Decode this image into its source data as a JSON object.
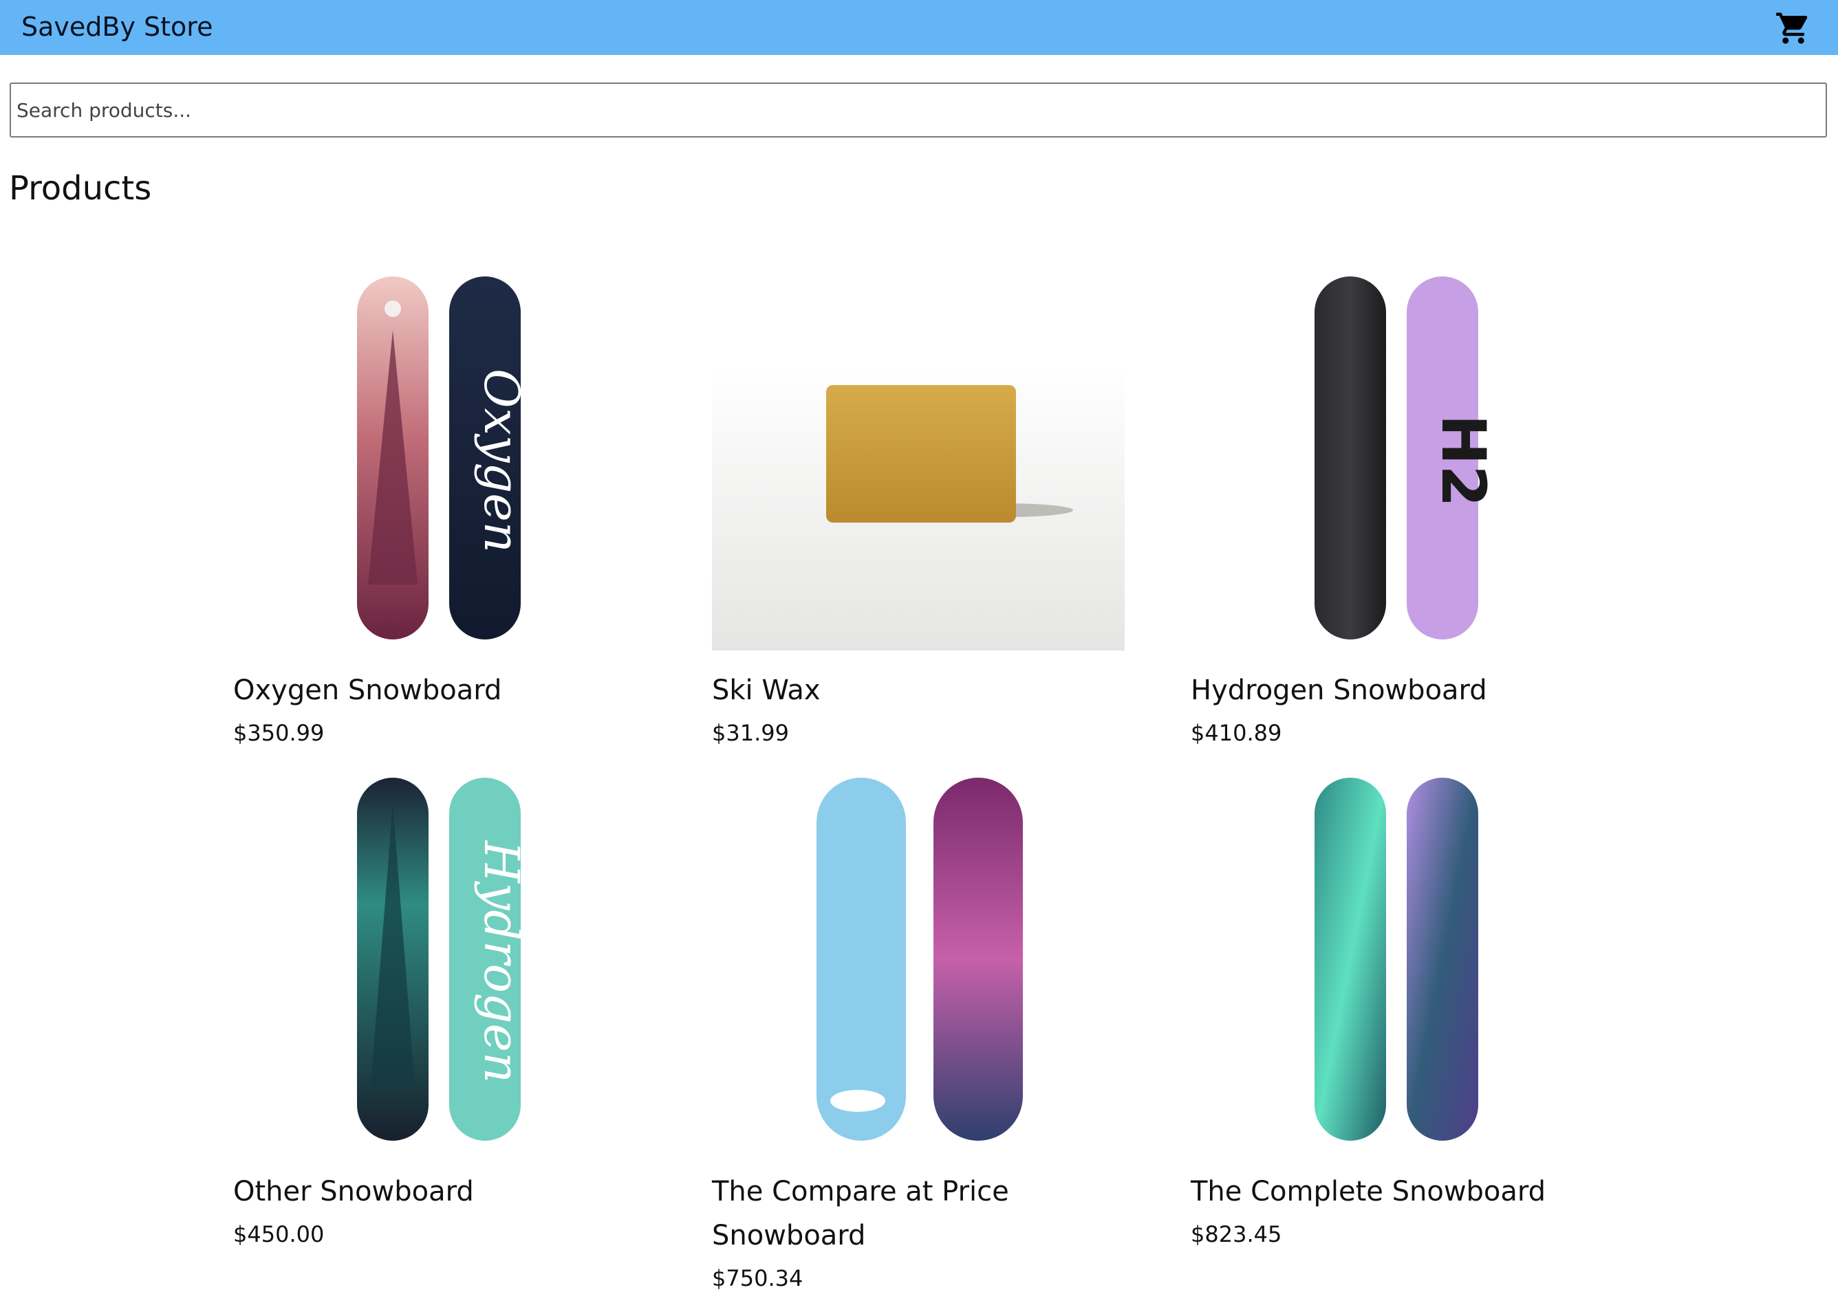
{
  "header": {
    "store_name": "SavedBy Store",
    "cart_icon": "shopping-cart-icon",
    "background": "#64b5f6"
  },
  "search": {
    "placeholder": "Search products..."
  },
  "main": {
    "title": "Products",
    "products": [
      {
        "name": "Oxygen Snowboard",
        "price": "$350.99",
        "image": "snowboard-pair-oxygen"
      },
      {
        "name": "Ski Wax",
        "price": "$31.99",
        "image": "ski-wax-bar"
      },
      {
        "name": "Hydrogen Snowboard",
        "price": "$410.89",
        "image": "snowboard-pair-hydrogen"
      },
      {
        "name": "Other Snowboard",
        "price": "$450.00",
        "image": "snowboard-pair-other"
      },
      {
        "name": "The Compare at Price Snowboard",
        "price": "$750.34",
        "image": "snowboard-pair-compare"
      },
      {
        "name": "The Complete Snowboard",
        "price": "$823.45",
        "image": "snowboard-pair-complete"
      }
    ]
  }
}
